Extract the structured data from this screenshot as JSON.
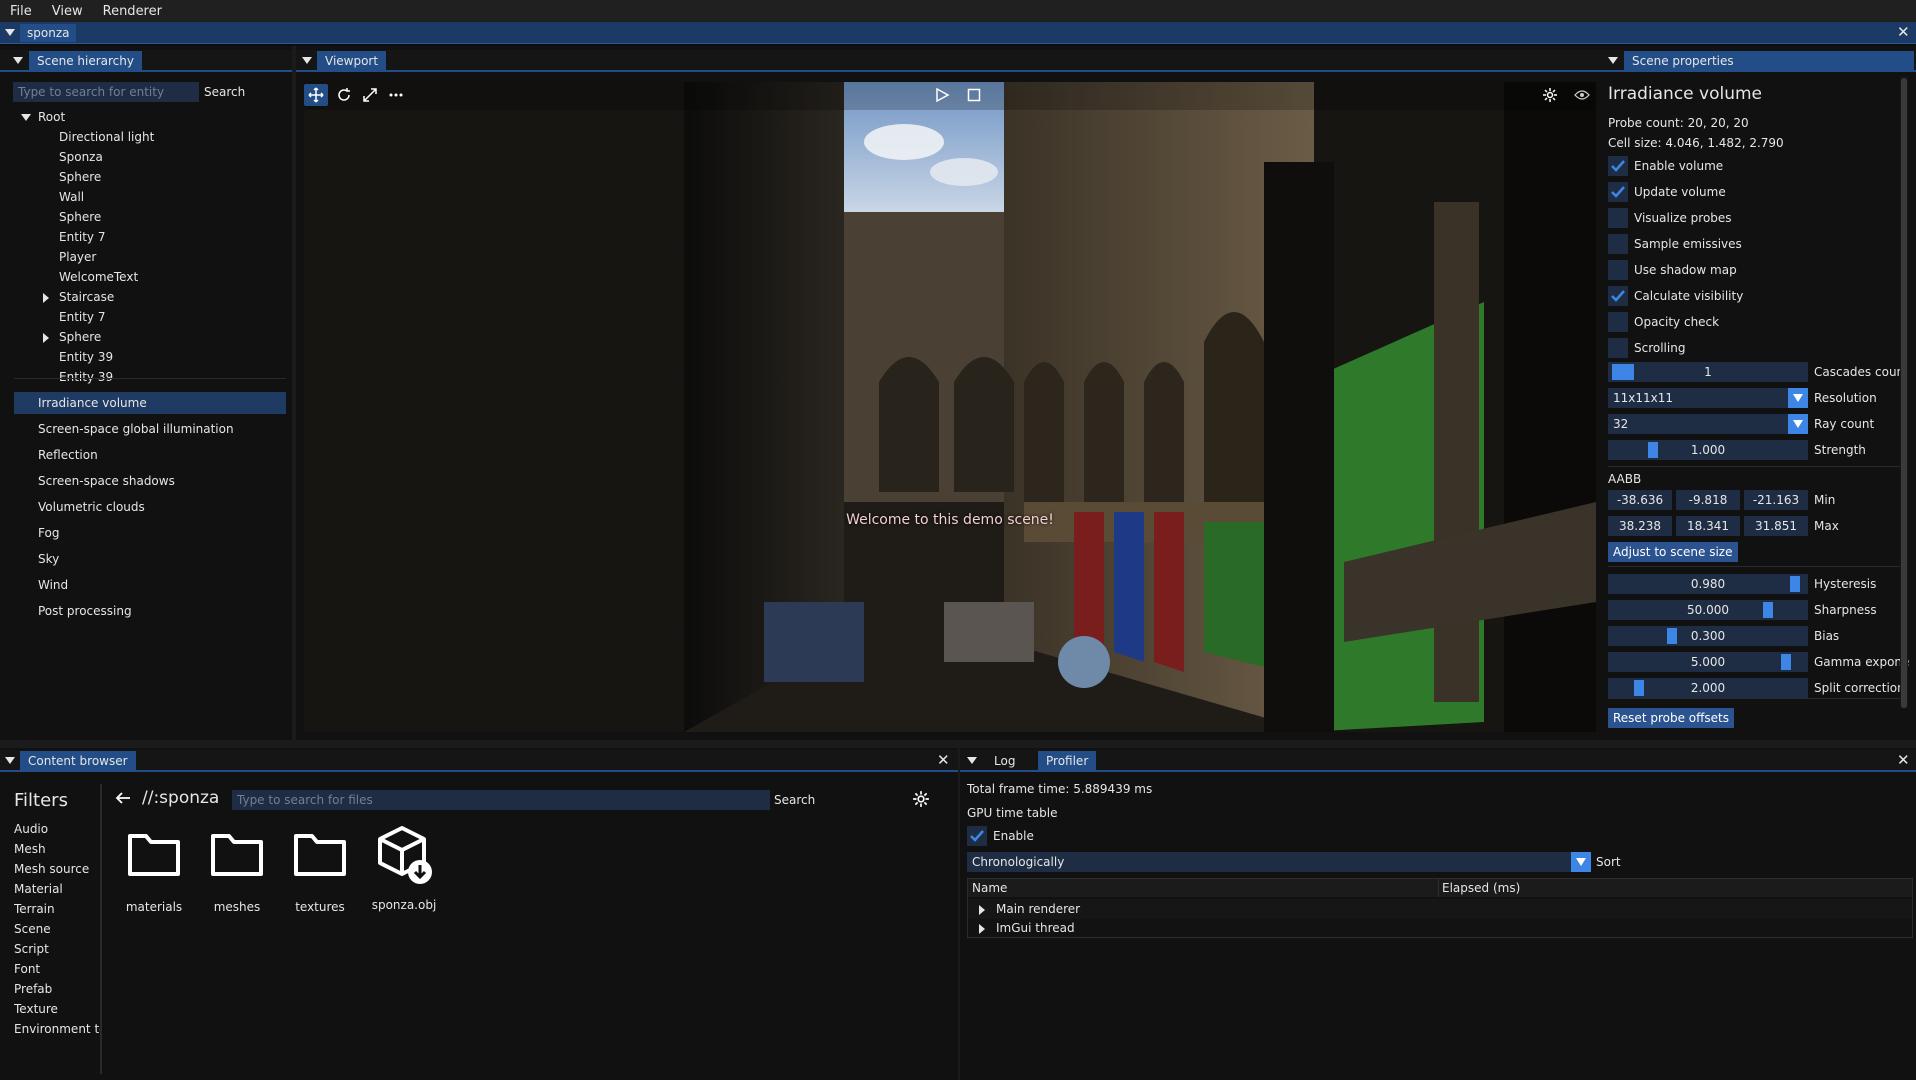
{
  "menubar": {
    "items": [
      "File",
      "View",
      "Renderer"
    ]
  },
  "document": {
    "tab": "sponza"
  },
  "hierarchy": {
    "tab": "Scene hierarchy",
    "search_placeholder": "Type to search for entity",
    "search_label": "Search",
    "tree": [
      {
        "label": "Root",
        "depth": 0,
        "expander": "open"
      },
      {
        "label": "Directional light",
        "depth": 1
      },
      {
        "label": "Sponza",
        "depth": 1
      },
      {
        "label": "Sphere",
        "depth": 1
      },
      {
        "label": "Wall",
        "depth": 1
      },
      {
        "label": "Sphere",
        "depth": 1
      },
      {
        "label": "Entity 7",
        "depth": 1
      },
      {
        "label": "Player",
        "depth": 1
      },
      {
        "label": "WelcomeText",
        "depth": 1
      },
      {
        "label": "Staircase",
        "depth": 1,
        "expander": "closed"
      },
      {
        "label": "Entity 7",
        "depth": 1
      },
      {
        "label": "Sphere",
        "depth": 1,
        "expander": "closed"
      },
      {
        "label": "Entity 39",
        "depth": 1
      },
      {
        "label": "Entity 39",
        "depth": 1
      }
    ],
    "effects": [
      "Irradiance volume",
      "Screen-space global illumination",
      "Reflection",
      "Screen-space shadows",
      "Volumetric clouds",
      "Fog",
      "Sky",
      "Wind",
      "Post processing"
    ],
    "selected_effect": "Irradiance volume"
  },
  "viewport": {
    "tab": "Viewport",
    "overlay_text": "Welcome to this demo scene!"
  },
  "properties": {
    "tab": "Scene properties",
    "title": "Irradiance volume",
    "probe_count": "Probe count: 20, 20, 20",
    "cell_size": "Cell size: 4.046, 1.482, 2.790",
    "checkboxes": [
      {
        "label": "Enable volume",
        "checked": true
      },
      {
        "label": "Update volume",
        "checked": true
      },
      {
        "label": "Visualize probes",
        "checked": false
      },
      {
        "label": "Sample emissives",
        "checked": false
      },
      {
        "label": "Use shadow map",
        "checked": false
      },
      {
        "label": "Calculate visibility",
        "checked": true
      },
      {
        "label": "Opacity check",
        "checked": false
      },
      {
        "label": "Scrolling",
        "checked": false
      }
    ],
    "cascades": {
      "value": "1",
      "label": "Cascades coun"
    },
    "resolution": {
      "value": "11x11x11",
      "label": "Resolution"
    },
    "ray_count": {
      "value": "32",
      "label": "Ray count"
    },
    "strength": {
      "value": "1.000",
      "label": "Strength",
      "fraction": 0.2
    },
    "aabb_label": "AABB",
    "aabb_min": {
      "values": [
        "-38.636",
        "-9.818",
        "-21.163"
      ],
      "label": "Min"
    },
    "aabb_max": {
      "values": [
        "38.238",
        "18.341",
        "31.851"
      ],
      "label": "Max"
    },
    "adjust_button": "Adjust to scene size",
    "sliders": [
      {
        "value": "0.980",
        "label": "Hysteresis",
        "fraction": 0.98
      },
      {
        "value": "50.000",
        "label": "Sharpness",
        "fraction": 0.83
      },
      {
        "value": "0.300",
        "label": "Bias",
        "fraction": 0.3
      },
      {
        "value": "5.000",
        "label": "Gamma expone",
        "fraction": 0.93
      },
      {
        "value": "2.000",
        "label": "Split correction",
        "fraction": 0.12
      }
    ],
    "reset_button": "Reset probe offsets"
  },
  "content_browser": {
    "tab": "Content browser",
    "filters_title": "Filters",
    "filters": [
      "Audio",
      "Mesh",
      "Mesh source",
      "Material",
      "Terrain",
      "Scene",
      "Script",
      "Font",
      "Prefab",
      "Texture",
      "Environment tex"
    ],
    "path": "//:sponza",
    "search_placeholder": "Type to search for files",
    "search_label": "Search",
    "items": [
      {
        "name": "materials",
        "icon": "folder-icon"
      },
      {
        "name": "meshes",
        "icon": "folder-icon"
      },
      {
        "name": "textures",
        "icon": "folder-icon"
      },
      {
        "name": "sponza.obj",
        "icon": "mesh-file-icon"
      }
    ]
  },
  "profiler": {
    "tabs": [
      "Log",
      "Profiler"
    ],
    "active_tab": "Profiler",
    "frame_time": "Total frame time: 5.889439 ms",
    "gpu_title": "GPU time table",
    "enable_label": "Enable",
    "enable_checked": true,
    "sort_value": "Chronologically",
    "sort_label": "Sort",
    "table_headers": [
      "Name",
      "Elapsed (ms)"
    ],
    "rows": [
      "Main renderer",
      "ImGui thread"
    ]
  },
  "colors": {
    "accent": "#3d86e6",
    "tab": "#234d86",
    "frame": "#1f2d44"
  }
}
